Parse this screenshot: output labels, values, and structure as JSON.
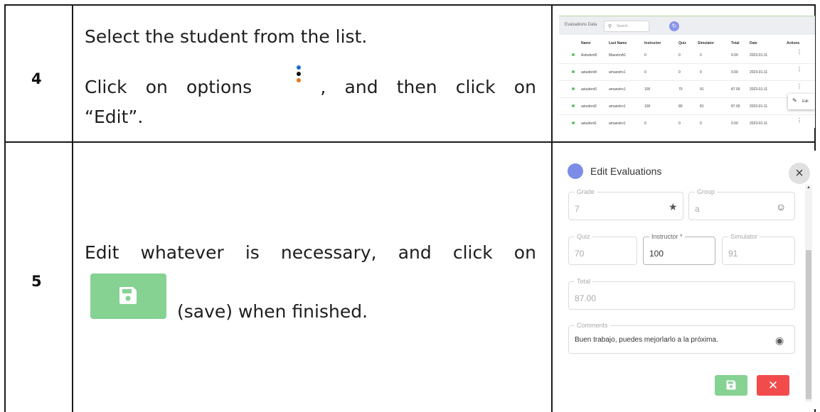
{
  "steps": [
    {
      "number": "4",
      "line1": "Select the student from the list.",
      "line2_words": [
        "Click",
        "on",
        "options",
        ",",
        "and",
        "then",
        "click",
        "on"
      ],
      "line3": "“Edit”."
    },
    {
      "number": "5",
      "line1_words": [
        "Edit",
        "whatever",
        "is",
        "necessary,",
        "and",
        "click",
        "on"
      ],
      "line2": "(save) when finished."
    }
  ],
  "list_screenshot": {
    "title": "Evaluations Data",
    "search_placeholder": "Search",
    "columns": [
      "Name",
      "Last Name",
      "Instructor",
      "Quiz",
      "Simulator",
      "Total",
      "Date",
      "Actions"
    ],
    "rows": [
      [
        "Astudent5",
        "MaestroA1",
        "0",
        "0",
        "0",
        "0.00",
        "2023-01-11"
      ],
      [
        "astudent4",
        "amaestro1",
        "0",
        "0",
        "0",
        "0.00",
        "2023-01-11"
      ],
      [
        "astudent3",
        "amaestro1",
        "100",
        "70",
        "91",
        "87.00",
        "2023-01-11"
      ],
      [
        "astudent2",
        "amaestro1",
        "100",
        "80",
        "81",
        "87.00",
        "2023-01-11"
      ],
      [
        "astudent1",
        "amaestro1",
        "0",
        "0",
        "0",
        "0.00",
        "2023-01-11"
      ]
    ],
    "menu_item": "Edit",
    "accent_color": "#8a95e8",
    "status_color": "#5cc26a"
  },
  "edit_dialog": {
    "title": "Edit Evaluations",
    "grade_label": "Grade",
    "grade_value": "7",
    "group_label": "Group",
    "group_value": "a",
    "quiz_label": "Quiz",
    "quiz_value": "70",
    "instructor_label": "Instructor *",
    "instructor_value": "100",
    "simulator_label": "Simulator",
    "simulator_value": "91",
    "total_label": "Total",
    "total_value": "87.00",
    "comments_label": "Comments",
    "comments_value": "Buen trabajo, puedes mejorlarlo a la próxima.",
    "save_color": "#86d293",
    "cancel_color": "#f24b4b"
  },
  "icons": [
    "options-kebab-icon",
    "save-floppy-icon",
    "search-icon",
    "refresh-icon",
    "pencil-icon",
    "close-icon",
    "star-icon",
    "group-icon",
    "eye-icon",
    "avatar-icon"
  ]
}
